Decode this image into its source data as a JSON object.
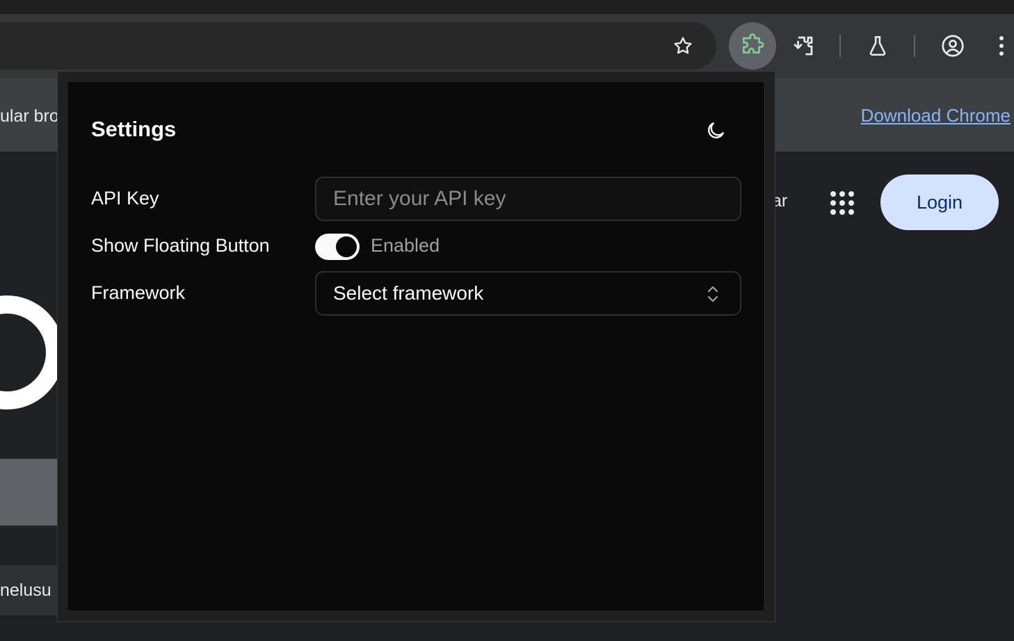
{
  "browser": {
    "icons": [
      "star-icon",
      "puzzle-icon",
      "extension-icon",
      "flask-icon",
      "account-circle-icon",
      "more-vert-icon"
    ]
  },
  "background_page": {
    "infobar_text": "ular bro",
    "download_link": "Download Chrome",
    "signin_fragment": "ar",
    "login_label": "Login",
    "bottom_fragment": "nelusu"
  },
  "popup": {
    "title": "Settings",
    "theme_icon": "moon-icon",
    "api_key": {
      "label": "API Key",
      "placeholder": "Enter your API key",
      "value": ""
    },
    "floating_button": {
      "label": "Show Floating Button",
      "state_text": "Enabled",
      "enabled": true
    },
    "framework": {
      "label": "Framework",
      "value": "Select framework"
    }
  },
  "colors": {
    "popup_bg": "#0a0a0a",
    "active_extension": "#81c995",
    "login_bg": "#d3e3fd",
    "link": "#8ab4f8"
  }
}
